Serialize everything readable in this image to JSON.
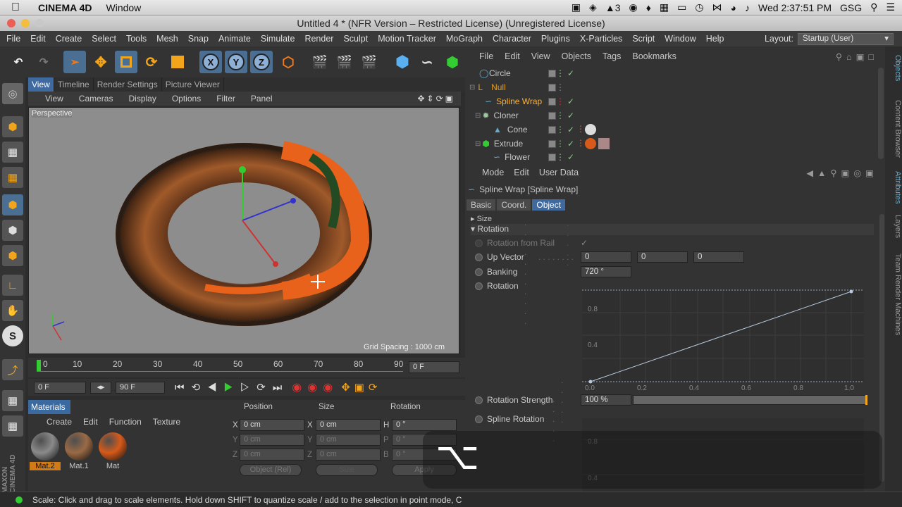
{
  "mac_menubar": {
    "app_name": "CINEMA 4D",
    "window_menu": "Window",
    "date_time": "Wed 2:37:51 PM",
    "user": "GSG",
    "badge_count": "3"
  },
  "window": {
    "title": "Untitled 4 * (NFR Version – Restricted License) (Unregistered License)"
  },
  "menubar": {
    "items": [
      "File",
      "Edit",
      "Create",
      "Select",
      "Tools",
      "Mesh",
      "Snap",
      "Animate",
      "Simulate",
      "Render",
      "Sculpt",
      "Motion Tracker",
      "MoGraph",
      "Character",
      "Plugins",
      "X-Particles",
      "Script",
      "Window",
      "Help"
    ],
    "layout_label": "Layout:",
    "layout_value": "Startup (User)"
  },
  "toolbar": {
    "x_label": "X",
    "y_label": "Y",
    "z_label": "Z"
  },
  "viewport_tabs": [
    "View",
    "Timeline",
    "Render Settings",
    "Picture Viewer"
  ],
  "viewport_menu": [
    "View",
    "Cameras",
    "Display",
    "Options",
    "Filter",
    "Panel"
  ],
  "viewport": {
    "label": "Perspective",
    "grid_spacing": "Grid Spacing : 1000 cm"
  },
  "timeline": {
    "ticks": [
      "0",
      "10",
      "20",
      "30",
      "40",
      "50",
      "60",
      "70",
      "80",
      "90"
    ],
    "current_frame": "0 F",
    "start_frame": "0 F",
    "end_frame": "90 F"
  },
  "materials": {
    "title": "Materials",
    "menu": [
      "Create",
      "Edit",
      "Function",
      "Texture"
    ],
    "items": [
      {
        "name": "Mat.2",
        "color": "#8a8a8a"
      },
      {
        "name": "Mat.1",
        "color": "#9a6a45"
      },
      {
        "name": "Mat",
        "color": "#d65a1a"
      }
    ]
  },
  "coords": {
    "headers": [
      "Position",
      "Size",
      "Rotation"
    ],
    "rows": [
      {
        "pos_axis": "X",
        "pos": "0 cm",
        "size_axis": "X",
        "size": "0 cm",
        "rot_axis": "H",
        "rot": "0 °"
      },
      {
        "pos_axis": "Y",
        "pos": "0 cm",
        "size_axis": "Y",
        "size": "0 cm",
        "rot_axis": "P",
        "rot": "0 °"
      },
      {
        "pos_axis": "Z",
        "pos": "0 cm",
        "size_axis": "Z",
        "size": "0 cm",
        "rot_axis": "B",
        "rot": "0 °"
      }
    ],
    "mode": "Object (Rel)",
    "size_mode": "Size",
    "apply": "Apply"
  },
  "object_manager": {
    "menu": [
      "File",
      "Edit",
      "View",
      "Objects",
      "Tags",
      "Bookmarks"
    ],
    "objects": [
      {
        "name": "Circle",
        "indent": 0,
        "color": "#c8c8c8"
      },
      {
        "name": "Null",
        "indent": 0,
        "color": "#e0a020"
      },
      {
        "name": "Spline Wrap",
        "indent": 1,
        "color": "#ffb030"
      },
      {
        "name": "Cloner",
        "indent": 1,
        "color": "#c8c8c8"
      },
      {
        "name": "Cone",
        "indent": 2,
        "color": "#c8c8c8"
      },
      {
        "name": "Extrude",
        "indent": 1,
        "color": "#c8c8c8"
      },
      {
        "name": "Flower",
        "indent": 2,
        "color": "#c8c8c8"
      }
    ]
  },
  "attributes": {
    "menu": [
      "Mode",
      "Edit",
      "User Data"
    ],
    "object_title": "Spline Wrap [Spline Wrap]",
    "tabs": [
      "Basic",
      "Coord.",
      "Object"
    ],
    "active_tab": "Object",
    "section_size": "Size",
    "section_rotation": "Rotation",
    "rotation_from_rail": "Rotation from Rail",
    "up_vector_label": "Up Vector",
    "up_vector": [
      "0",
      "0",
      "0"
    ],
    "banking_label": "Banking",
    "banking": "720 °",
    "rotation_label": "Rotation",
    "graph_y_ticks": [
      "0.8",
      "0.4",
      "0.0"
    ],
    "graph_x_ticks": [
      "0.2",
      "0.4",
      "0.6",
      "0.8",
      "1.0"
    ],
    "rotation_strength_label": "Rotation Strength",
    "rotation_strength": "100 %",
    "rotation_strength_fraction": 1.0,
    "spline_rotation_label": "Spline Rotation",
    "graph2_y_ticks": [
      "0.8",
      "0.4"
    ]
  },
  "side_tabs": [
    "Objects",
    "Content Browser",
    "Attributes",
    "Layers",
    "Team Render Machines"
  ],
  "status": "Scale: Click and drag to scale elements. Hold down SHIFT to quantize scale / add to the selection in point mode, C",
  "key_overlay": "⌥",
  "brand": "MAXON CINEMA 4D"
}
